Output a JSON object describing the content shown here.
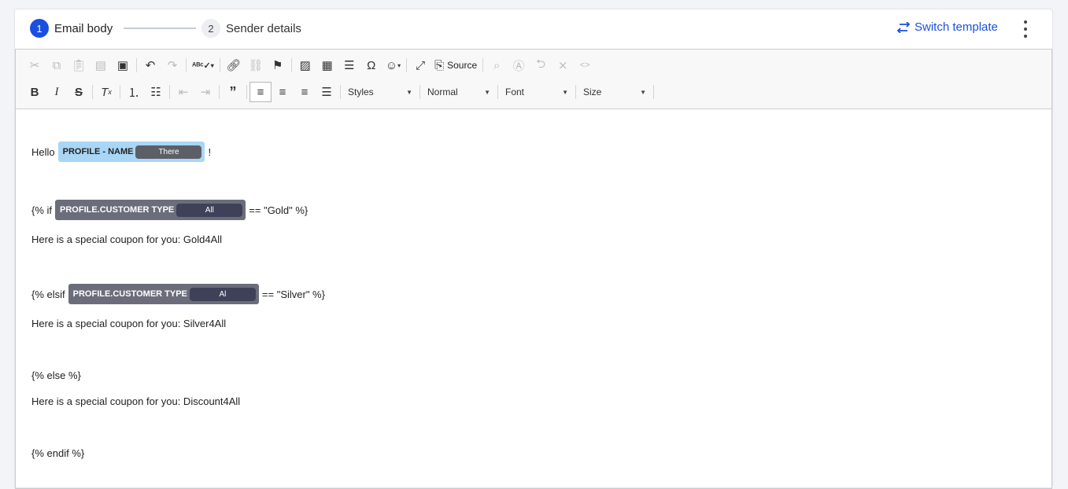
{
  "stepper": {
    "step1": {
      "number": "1",
      "label": "Email body"
    },
    "step2": {
      "number": "2",
      "label": "Sender details"
    }
  },
  "header": {
    "switch_label": "Switch template",
    "more_icon": "more-vertical-icon"
  },
  "toolbar": {
    "source_label": "Source",
    "styles": "Styles",
    "format": "Normal",
    "font": "Font",
    "size": "Size"
  },
  "body": {
    "greeting_prefix": "Hello",
    "greeting_tag_label": "PROFILE - NAME",
    "greeting_tag_value": "There",
    "greeting_suffix": "!",
    "if_prefix": "{% if",
    "if_tag_label": "PROFILE.CUSTOMER TYPE",
    "if_tag_value": "All",
    "if_suffix": "== \"Gold\" %}",
    "gold_text": "Here is a special coupon for you: Gold4All",
    "elsif_prefix": "{% elsif",
    "elsif_tag_label": "PROFILE.CUSTOMER TYPE",
    "elsif_tag_value": "Al",
    "elsif_suffix": "== \"Silver\" %}",
    "silver_text": "Here is a special coupon for you: Silver4All",
    "else_text": "{% else %}",
    "discount_text": "Here is a special coupon for you: Discount4All",
    "endif_text": "{% endif %}"
  },
  "colors": {
    "accent": "#1a4fe0",
    "tag_blue": "#a9d6f5",
    "tag_dark": "#6b6d7b"
  }
}
